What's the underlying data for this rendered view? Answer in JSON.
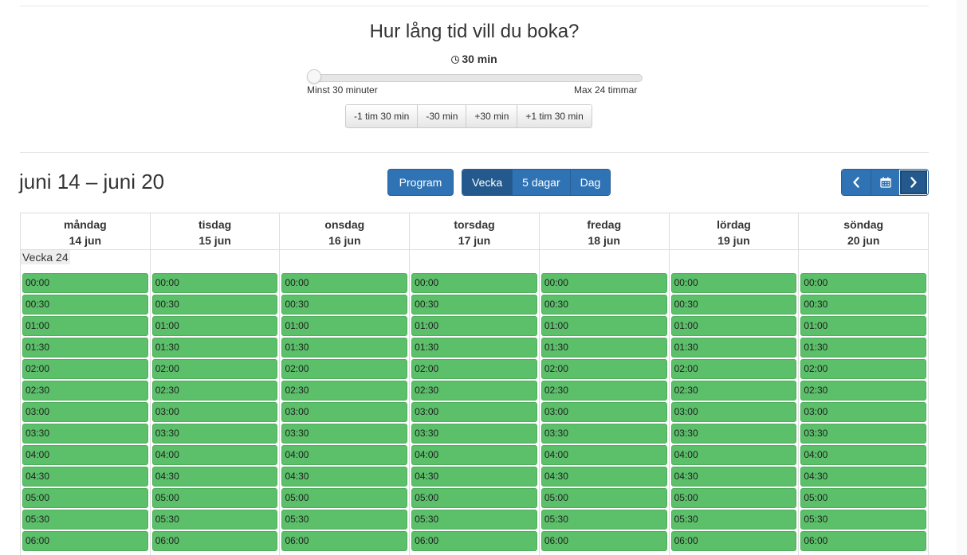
{
  "duration": {
    "title": "Hur lång tid vill du boka?",
    "value": "30 min",
    "min_label": "Minst 30 minuter",
    "max_label": "Max 24 timmar",
    "slider_fraction": 0.0,
    "adjust_buttons": [
      "-1 tim 30 min",
      "-30 min",
      "+30 min",
      "+1 tim 30 min"
    ]
  },
  "toolbar": {
    "range_title": "juni 14 – juni 20",
    "program_label": "Program",
    "views": [
      "Vecka",
      "5 dagar",
      "Dag"
    ],
    "active_view": "Vecka",
    "prev_icon": "chevron-left-icon",
    "calendar_icon": "calendar-icon",
    "next_icon": "chevron-right-icon"
  },
  "calendar": {
    "week_label": "Vecka 24",
    "days": [
      {
        "name": "måndag",
        "date": "14 jun"
      },
      {
        "name": "tisdag",
        "date": "15 jun"
      },
      {
        "name": "onsdag",
        "date": "16 jun"
      },
      {
        "name": "torsdag",
        "date": "17 jun"
      },
      {
        "name": "fredag",
        "date": "18 jun"
      },
      {
        "name": "lördag",
        "date": "19 jun"
      },
      {
        "name": "söndag",
        "date": "20 jun"
      }
    ],
    "slots": [
      "00:00",
      "00:30",
      "01:00",
      "01:30",
      "02:00",
      "02:30",
      "03:00",
      "03:30",
      "04:00",
      "04:30",
      "05:00",
      "05:30",
      "06:00"
    ],
    "slot_color": "#5cbf6a"
  },
  "colors": {
    "primary": "#2f73b4",
    "primary_active": "#23598d",
    "available": "#5cbf6a"
  }
}
